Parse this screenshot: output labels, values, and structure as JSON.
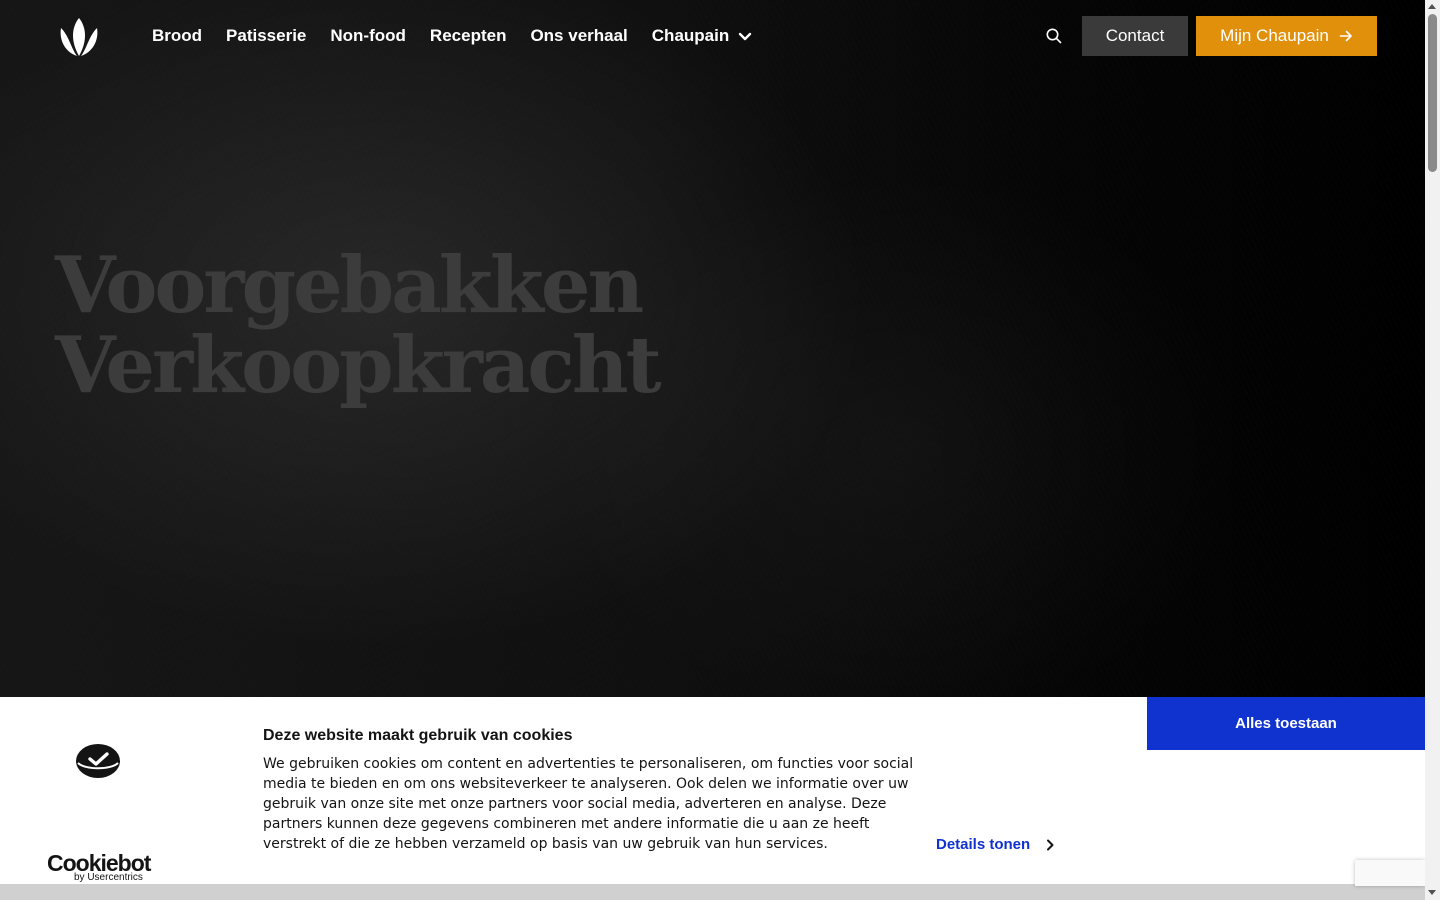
{
  "header": {
    "logo": "chaupain-flame-logo",
    "nav": [
      {
        "label": "Brood"
      },
      {
        "label": "Patisserie"
      },
      {
        "label": "Non-food"
      },
      {
        "label": "Recepten"
      },
      {
        "label": "Ons verhaal"
      },
      {
        "label": "Chaupain",
        "has_dropdown": true
      }
    ],
    "search_icon": "search-icon",
    "contact_label": "Contact",
    "mijn_label": "Mijn Chaupain",
    "mijn_icon": "arrow-right-icon",
    "accent_color": "#e1900c"
  },
  "hero": {
    "title_line1": "Voorgebakken",
    "title_line2": "Verkoopkracht"
  },
  "cookie_banner": {
    "title": "Deze website maakt gebruik van cookies",
    "body": "We gebruiken cookies om content en advertenties te personaliseren, om functies voor social media te bieden en om ons websiteverkeer te analyseren. Ook delen we informatie over uw gebruik van onze site met onze partners voor social media, adverteren en analyse. Deze partners kunnen deze gegevens combineren met andere informatie die u aan ze heeft verstrekt of die ze hebben verzameld op basis van uw gebruik van hun services.",
    "details_label": "Details tonen",
    "allow_label": "Alles toestaan",
    "brand": "Cookiebot",
    "brand_sub": "by Usercentrics",
    "button_color": "#1032cf"
  }
}
